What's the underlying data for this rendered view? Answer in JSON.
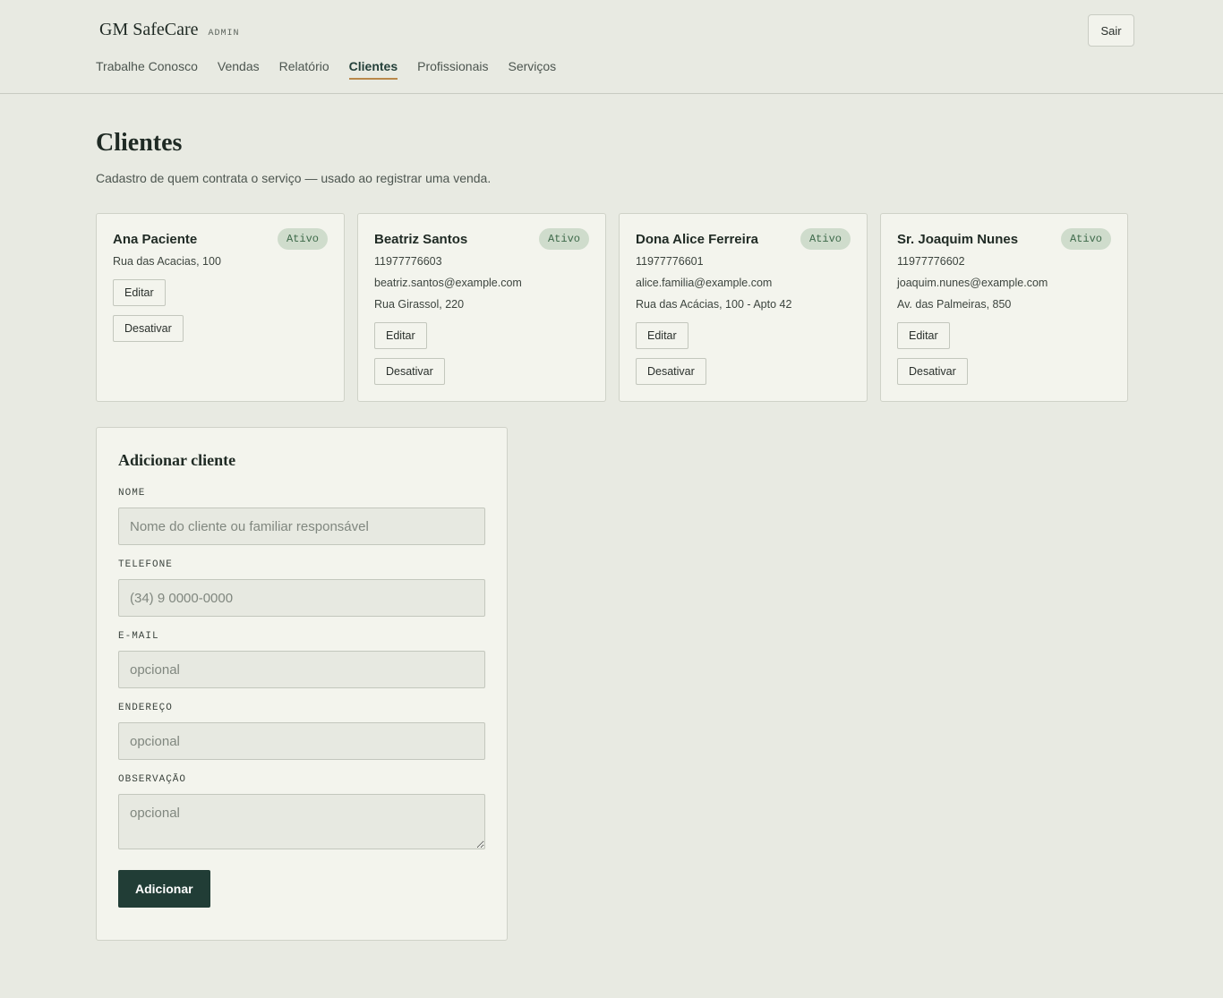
{
  "brand": {
    "name": "GM SafeCare",
    "tag": "ADMIN"
  },
  "header": {
    "logout_label": "Sair"
  },
  "nav": {
    "tabs": [
      {
        "label": "Trabalhe Conosco",
        "active": false
      },
      {
        "label": "Vendas",
        "active": false
      },
      {
        "label": "Relatório",
        "active": false
      },
      {
        "label": "Clientes",
        "active": true
      },
      {
        "label": "Profissionais",
        "active": false
      },
      {
        "label": "Serviços",
        "active": false
      }
    ]
  },
  "page": {
    "title": "Clientes",
    "subtitle": "Cadastro de quem contrata o serviço — usado ao registrar uma venda."
  },
  "clients": [
    {
      "name": "Ana Paciente",
      "status": "Ativo",
      "phone": "",
      "email": "",
      "address": "Rua das Acacias, 100",
      "edit_label": "Editar",
      "deactivate_label": "Desativar"
    },
    {
      "name": "Beatriz Santos",
      "status": "Ativo",
      "phone": "11977776603",
      "email": "beatriz.santos@example.com",
      "address": "Rua Girassol, 220",
      "edit_label": "Editar",
      "deactivate_label": "Desativar"
    },
    {
      "name": "Dona Alice Ferreira",
      "status": "Ativo",
      "phone": "11977776601",
      "email": "alice.familia@example.com",
      "address": "Rua das Acácias, 100 - Apto 42",
      "edit_label": "Editar",
      "deactivate_label": "Desativar"
    },
    {
      "name": "Sr. Joaquim Nunes",
      "status": "Ativo",
      "phone": "11977776602",
      "email": "joaquim.nunes@example.com",
      "address": "Av. das Palmeiras, 850",
      "edit_label": "Editar",
      "deactivate_label": "Desativar"
    }
  ],
  "form": {
    "title": "Adicionar cliente",
    "fields": {
      "name": {
        "label": "NOME",
        "placeholder": "Nome do cliente ou familiar responsável",
        "value": ""
      },
      "phone": {
        "label": "TELEFONE",
        "placeholder": "(34) 9 0000-0000",
        "value": ""
      },
      "email": {
        "label": "E-MAIL",
        "placeholder": "opcional",
        "value": ""
      },
      "address": {
        "label": "ENDEREÇO",
        "placeholder": "opcional",
        "value": ""
      },
      "note": {
        "label": "OBSERVAÇÃO",
        "placeholder": "opcional",
        "value": ""
      }
    },
    "submit_label": "Adicionar"
  },
  "colors": {
    "background": "#e8eae2",
    "card": "#f3f4ed",
    "primary_button": "#213d36",
    "active_tab_underline": "#b9884a",
    "badge_bg": "#cfdccc",
    "badge_text": "#3e6a4a"
  }
}
